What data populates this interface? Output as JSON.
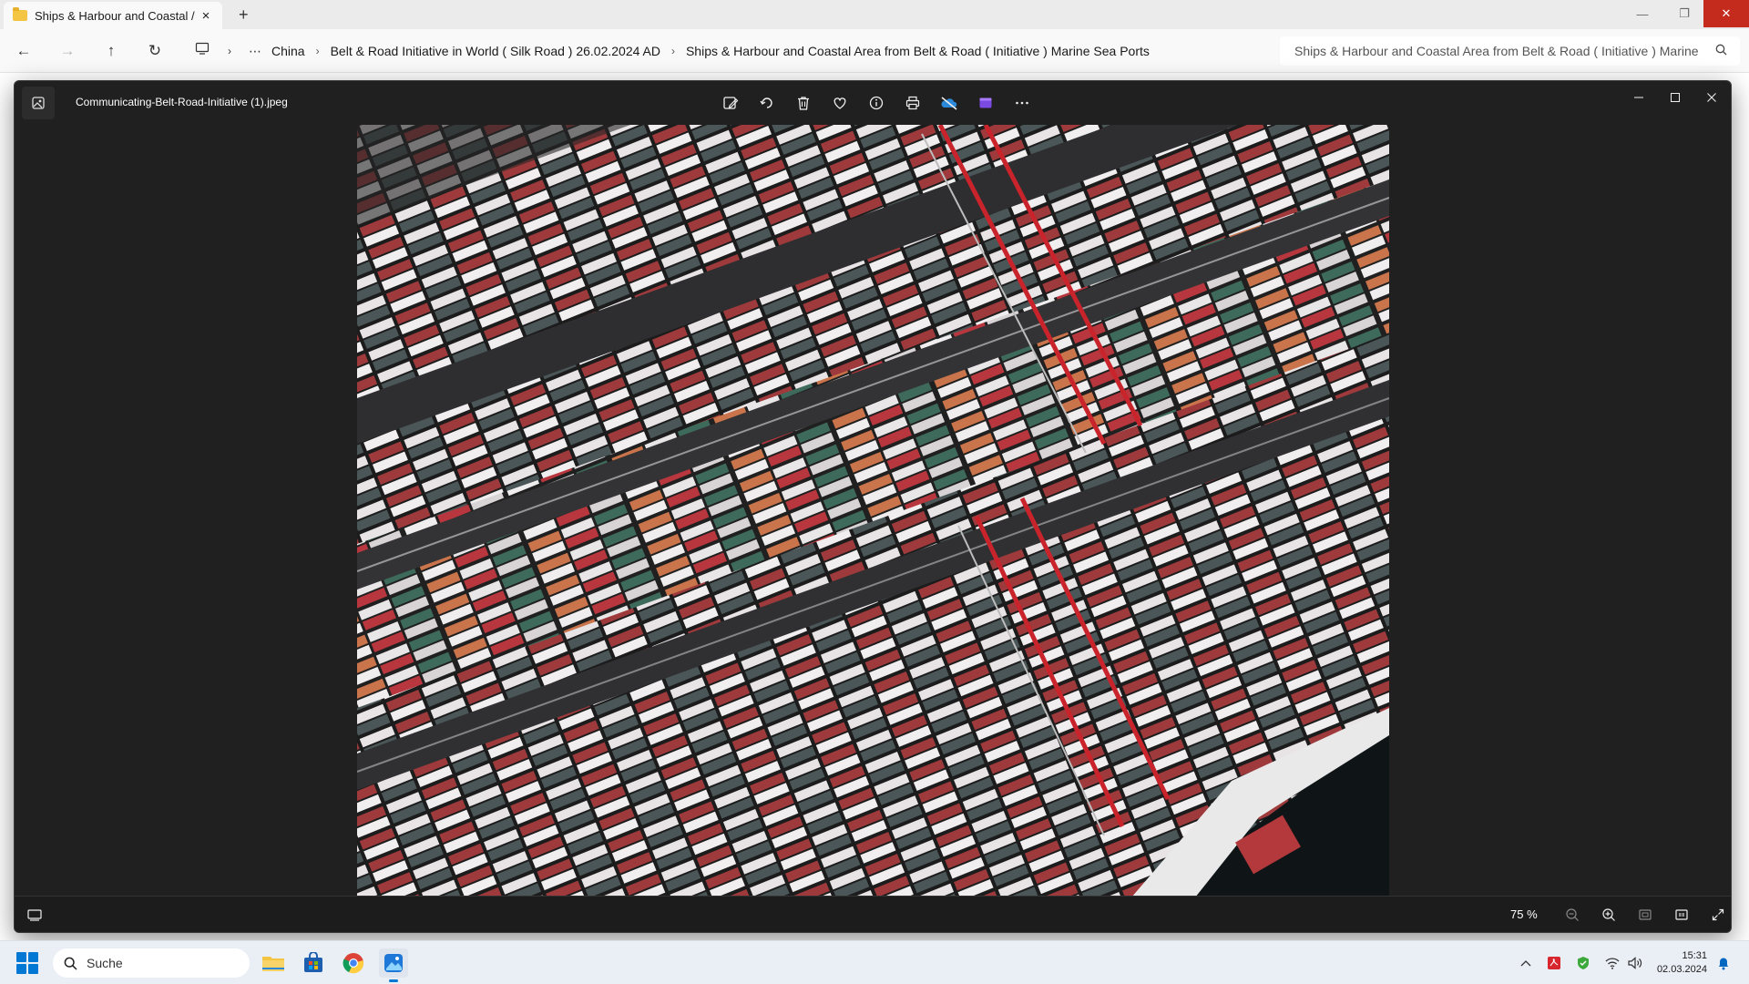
{
  "explorer": {
    "tab_title": "Ships & Harbour and Coastal /",
    "breadcrumb": [
      "China",
      "Belt & Road Initiative in World ( Silk Road ) 26.02.2024 AD",
      "Ships & Harbour and Coastal Area  from Belt & Road ( Initiative ) Marine Sea Ports"
    ],
    "search_value": "Ships & Harbour and Coastal Area  from Belt & Road ( Initiative ) Marine"
  },
  "photos": {
    "file_name": "Communicating-Belt-Road-Initiative (1).jpeg",
    "zoom": "75 %"
  },
  "taskbar": {
    "search_placeholder": "Suche",
    "time": "15:31",
    "date": "02.03.2024"
  },
  "colors": {
    "accent": "#0078d4",
    "close_red": "#c42b1c",
    "viewer_bg": "#202020"
  }
}
